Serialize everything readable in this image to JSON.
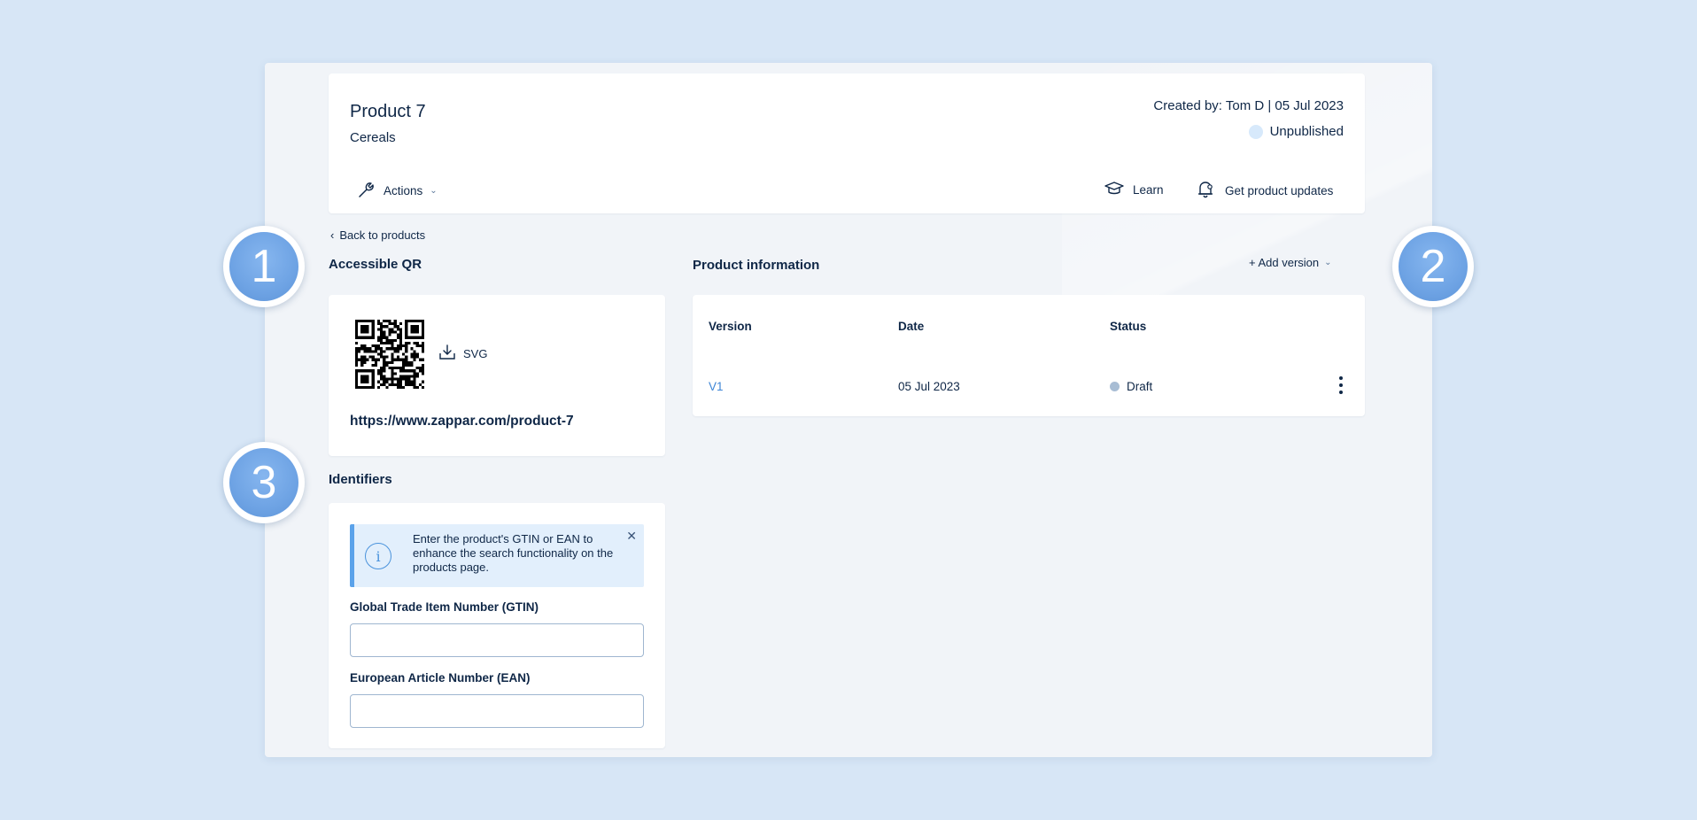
{
  "header": {
    "title": "Product 7",
    "category": "Cereals",
    "created_by": "Created by: Tom D | 05 Jul 2023",
    "status": "Unpublished",
    "actions_label": "Actions",
    "learn_label": "Learn",
    "updates_label": "Get product updates"
  },
  "nav": {
    "back_label": "Back to products"
  },
  "qr_section": {
    "title": "Accessible QR",
    "download_label": "SVG",
    "url": "https://www.zappar.com/product-7"
  },
  "product_info": {
    "title": "Product information",
    "add_version_label": "+ Add version",
    "columns": [
      "Version",
      "Date",
      "Status"
    ],
    "rows": [
      {
        "version": "V1",
        "date": "05 Jul 2023",
        "status": "Draft"
      }
    ]
  },
  "identifiers": {
    "title": "Identifiers",
    "banner_text": "Enter the product's GTIN or EAN to enhance the search functionality on the products page.",
    "gtin_label": "Global Trade Item Number (GTIN)",
    "gtin_value": "",
    "ean_label": "European Article Number (EAN)",
    "ean_value": ""
  },
  "markers": [
    "1",
    "2",
    "3"
  ],
  "colors": {
    "page_background": "#d7e6f6",
    "accent_blue": "#3f86d6",
    "text_dark": "#0f2747",
    "marker_blue": "#6ea3e4"
  }
}
